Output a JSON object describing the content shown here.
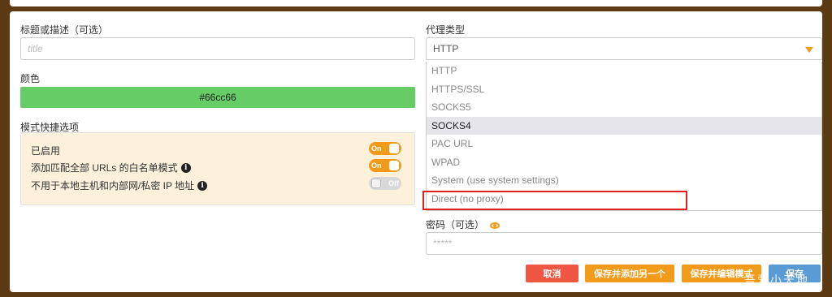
{
  "form": {
    "title_label": "标题或描述（可选）",
    "title_placeholder": "title",
    "color_label": "颜色",
    "color_value": "#66cc66",
    "options_label": "模式快捷选项",
    "options": [
      {
        "label": "已启用",
        "toggle": "On",
        "state": "on",
        "info": false
      },
      {
        "label": "添加匹配全部 URLs 的白名单模式",
        "toggle": "On",
        "state": "on",
        "info": true
      },
      {
        "label": "不用于本地主机和内部网/私密 IP 地址",
        "toggle": "Off",
        "state": "off",
        "info": true
      }
    ],
    "proxy_type_label": "代理类型",
    "proxy_type_value": "HTTP",
    "proxy_options": [
      "HTTP",
      "HTTPS/SSL",
      "SOCKS5",
      "SOCKS4",
      "PAC URL",
      "WPAD",
      "System (use system settings)",
      "Direct (no proxy)"
    ],
    "proxy_options_active_index": 3,
    "password_label": "密码（可选）",
    "password_placeholder": "*****"
  },
  "buttons": {
    "cancel": "取消",
    "save_add": "保存并添加另一个",
    "save_edit": "保存并编辑模式",
    "save": "保存"
  },
  "watermark": "吾爱小天地",
  "colors": {
    "accent": "#f29b1a",
    "danger": "#ef5744",
    "primary": "#5b9bd5",
    "highlight": "#e0201c",
    "background": "#5c3a13"
  }
}
